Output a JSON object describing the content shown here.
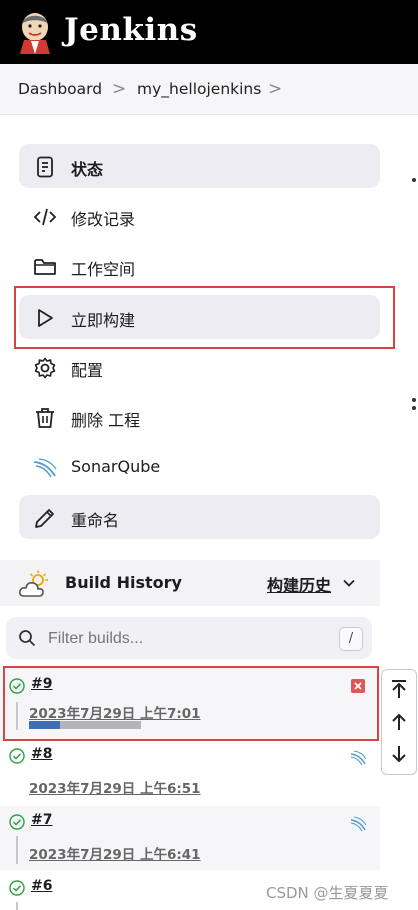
{
  "header": {
    "brand": "Jenkins",
    "logo_icon": "jenkins-butler-logo"
  },
  "breadcrumb": {
    "items": [
      "Dashboard",
      "my_hellojenkins"
    ],
    "separator": ">"
  },
  "tasks": [
    {
      "label": "状态",
      "icon": "status-icon",
      "active": true
    },
    {
      "label": "修改记录",
      "icon": "code-icon",
      "active": false
    },
    {
      "label": "工作空间",
      "icon": "folder-icon",
      "active": false
    },
    {
      "label": "立即构建",
      "icon": "play-icon",
      "active": true,
      "highlighted": true
    },
    {
      "label": "配置",
      "icon": "gear-icon",
      "active": false
    },
    {
      "label": "删除 工程",
      "icon": "trash-icon",
      "active": false
    },
    {
      "label": "SonarQube",
      "icon": "sonarqube-icon",
      "active": false
    },
    {
      "label": "重命名",
      "icon": "pencil-icon",
      "active": true
    }
  ],
  "build_history": {
    "title": "Build History",
    "title_cn": "构建历史",
    "filter_placeholder": "Filter builds...",
    "filter_shortcut": "/",
    "builds": [
      {
        "number": "#9",
        "date": "2023年7月29日 上午7:01",
        "status": "success",
        "running": true,
        "progress": 0.28,
        "highlighted": true
      },
      {
        "number": "#8",
        "date": "2023年7月29日 上午6:51",
        "status": "success"
      },
      {
        "number": "#7",
        "date": "2023年7月29日 上午6:41",
        "status": "success"
      },
      {
        "number": "#6",
        "date": "",
        "status": "success"
      }
    ]
  },
  "scroll_controls": [
    "scroll-to-top",
    "scroll-up",
    "scroll-down"
  ],
  "watermark": "CSDN @生夏夏夏",
  "colors": {
    "header_bg": "#000000",
    "highlight": "#d64545",
    "progress": "#3e6fb4",
    "success": "#2ea043"
  }
}
